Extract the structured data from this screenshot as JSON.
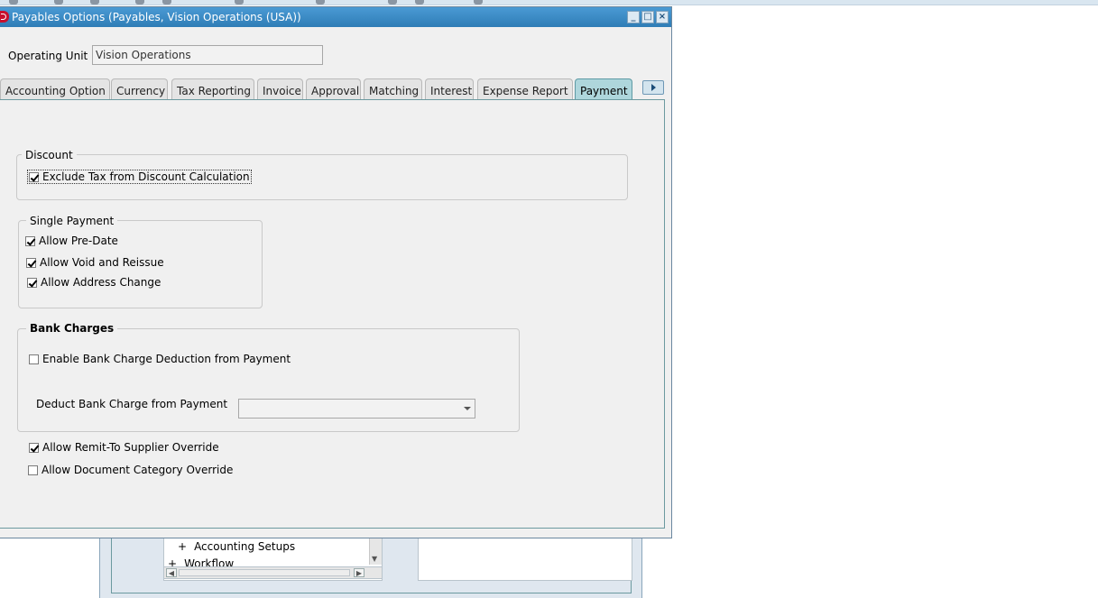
{
  "window": {
    "title": "Payables Options (Payables, Vision Operations (USA))",
    "minimize": "",
    "maximize": "",
    "close": ""
  },
  "operating_unit": {
    "label": "Operating Unit",
    "value": "Vision Operations"
  },
  "tabs": [
    {
      "label": "Accounting Option"
    },
    {
      "label": "Currency"
    },
    {
      "label": "Tax Reporting"
    },
    {
      "label": "Invoice"
    },
    {
      "label": "Approval"
    },
    {
      "label": "Matching"
    },
    {
      "label": "Interest"
    },
    {
      "label": "Expense Report"
    },
    {
      "label": "Payment",
      "active": true
    }
  ],
  "discount": {
    "title": "Discount",
    "exclude_tax": {
      "label": "Exclude Tax from Discount Calculation",
      "checked": true
    }
  },
  "single_payment": {
    "title": "Single Payment",
    "allow_pre_date": {
      "label": "Allow Pre-Date",
      "checked": true
    },
    "allow_void_reissue": {
      "label": "Allow Void and Reissue",
      "checked": true
    },
    "allow_address_change": {
      "label": "Allow Address Change",
      "checked": true
    }
  },
  "bank_charges": {
    "title": "Bank Charges",
    "enable_deduction": {
      "label": "Enable Bank Charge Deduction from Payment",
      "checked": false
    },
    "deduct_label": "Deduct Bank Charge from Payment",
    "deduct_value": ""
  },
  "remit_override": {
    "label": "Allow Remit-To Supplier Override",
    "checked": true
  },
  "doc_category_override": {
    "label": "Allow Document Category Override",
    "checked": false
  },
  "navigator": {
    "tree": [
      {
        "label": "Accounting Setups"
      },
      {
        "label": "Workflow"
      }
    ]
  },
  "colors": {
    "titlebar": "#3b89c2",
    "active_tab": "#aed6dc"
  }
}
